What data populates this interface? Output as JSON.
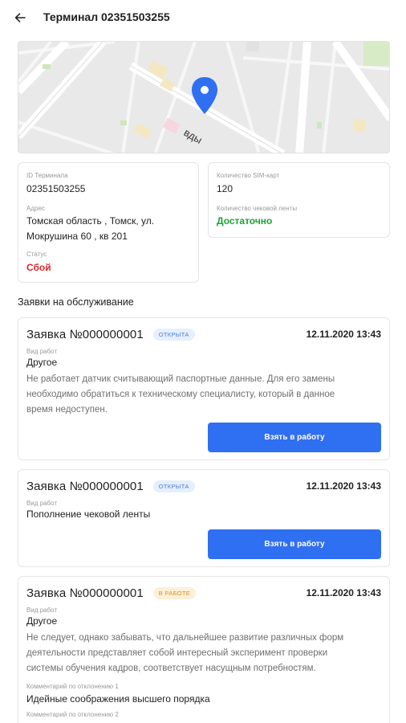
{
  "header": {
    "title": "Терминал 02351503255",
    "back_icon": "arrow-left-icon"
  },
  "map": {
    "street_label": "вды",
    "pin_color": "#2f6ff2"
  },
  "terminal": {
    "id_label": "ID Терминала",
    "id_value": "02351503255",
    "address_label": "Адрес",
    "address_line1": "Томская область , Томск, ул.",
    "address_line2": "Мокрушина 60 , кв 201",
    "status_label": "Статус",
    "status_value": "Сбой",
    "status_color": "#e0262a"
  },
  "sims": {
    "count_label": "Количество SIM-карт",
    "count_value": "120",
    "tape_label": "Количество чековой ленты",
    "tape_value": "Достаточно",
    "tape_color": "#1aa334"
  },
  "requests_title": "Заявки на обслуживание",
  "requests": [
    {
      "title": "Заявка №000000001",
      "badge": "открыта",
      "date": "12.11.2020 13:43",
      "work_label": "Вид работ",
      "work_value": "Другое",
      "desc_lines": [
        "Не работает датчик считывающий паспортные данные. Для его замены",
        "необходимо обратиться к техническому специалисту, который в данное",
        "время недоступен."
      ],
      "button": "Взять в работу"
    },
    {
      "title": "Заявка №000000001",
      "badge": "открыта",
      "date": "12.11.2020 13:43",
      "work_label": "Вид работ",
      "work_value": "Пополнение чековой ленты",
      "button": "Взять в работу"
    },
    {
      "title": "Заявка №000000001",
      "badge": "в работе",
      "date": "12.11.2020 13:43",
      "work_label": "Вид работ",
      "work_value": "Другое",
      "desc_lines": [
        "Не следует, однако забывать, что дальнейшее развитие различных форм",
        "деятельности представляет собой интересный эксперимент проверки",
        "системы обучения кадров, соответствует насущным потребностям."
      ],
      "comment1_label": "Комментарий по отклонению 1",
      "comment1_value": "Идейные соображения высшего порядка",
      "comment2_label": "Комментарий по отклонению 2"
    }
  ],
  "colors": {
    "primary": "#2f6ff2",
    "badge_open_bg": "#e6effe",
    "badge_work_bg": "#fdf0d8"
  }
}
